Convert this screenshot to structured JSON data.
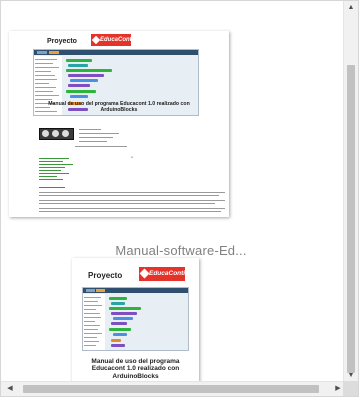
{
  "files": [
    {
      "name": "Manual-software-Ed...",
      "thumbnail": {
        "header_text": "Proyecto",
        "logo_text": "EducaConti",
        "title": "Manual de uso del programa Educacont 1.0 realizado con ArduinoBlocks"
      }
    },
    {
      "thumbnail": {
        "header_text": "Proyecto",
        "logo_text": "EducaConti",
        "title": "Manual de uso del programa Educacont 1.0 realizado con ArduinoBlocks"
      }
    }
  ],
  "scrollbars": {
    "up_arrow": "▲",
    "down_arrow": "▼",
    "left_arrow": "◀",
    "right_arrow": "▶"
  },
  "colors": {
    "logo_red": "#e6332a",
    "title_gray": "#808080",
    "scroll_track": "#f1f1f1",
    "scroll_thumb": "#c1c1c1"
  }
}
